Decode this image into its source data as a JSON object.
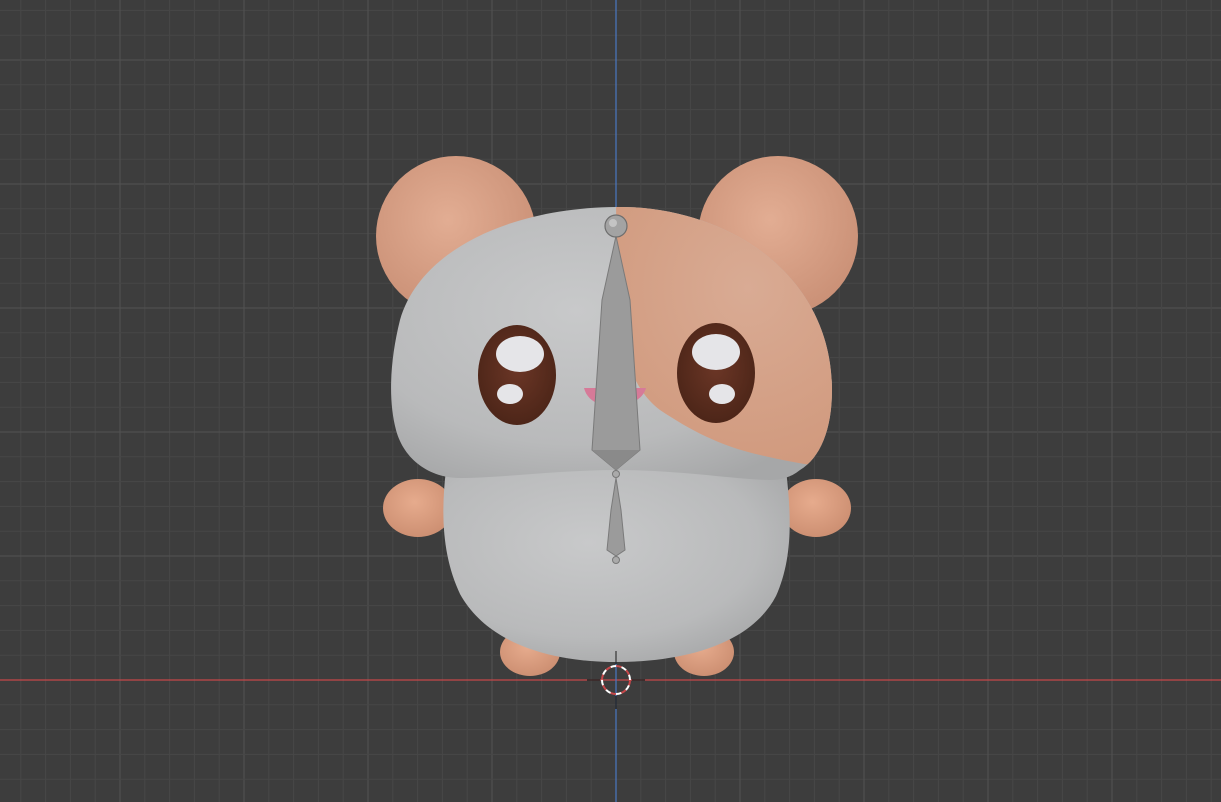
{
  "viewport": {
    "background_color": "#3d3d3d",
    "grid_minor_color": "#474747",
    "grid_major_color": "#525252",
    "x_axis_color": "#c6474a",
    "z_axis_color": "#4a77c2"
  },
  "scene": {
    "model": {
      "body_color": "#bfc0c1",
      "fur_color": "#d6a58b",
      "ear_color": "#dda38a",
      "limb_color": "#e0a385",
      "eye_color": "#5a2e1f",
      "eye_highlight_color": "#e5e5e8",
      "mouth_color": "#d67a98"
    },
    "armature": {
      "bone_color": "#9b9b9b",
      "bones": [
        "upper-bone",
        "lower-bone"
      ]
    },
    "cursor": {
      "icon": "3d-cursor-icon",
      "ring_color_a": "#c6474a",
      "ring_color_b": "#ffffff"
    }
  }
}
